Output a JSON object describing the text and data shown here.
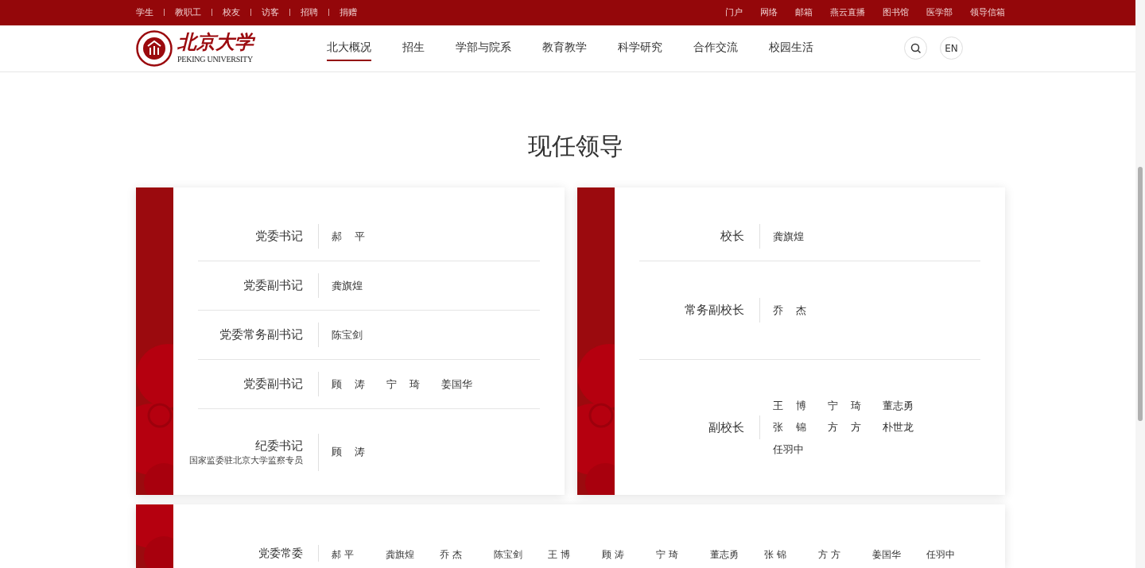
{
  "top_bar": {
    "left_links": [
      "学生",
      "教职工",
      "校友",
      "访客",
      "招聘",
      "捐赠"
    ],
    "right_links": [
      "门户",
      "网络",
      "邮箱",
      "燕云直播",
      "图书馆",
      "医学部",
      "领导信箱"
    ]
  },
  "header": {
    "logo": {
      "chinese": "北京大学",
      "english": "PEKING UNIVERSITY"
    },
    "nav": [
      {
        "label": "北大概况",
        "selected": true
      },
      {
        "label": "招生",
        "selected": false
      },
      {
        "label": "学部与院系",
        "selected": false
      },
      {
        "label": "教育教学",
        "selected": false
      },
      {
        "label": "科学研究",
        "selected": false
      },
      {
        "label": "合作交流",
        "selected": false
      },
      {
        "label": "校园生活",
        "selected": false
      }
    ],
    "language_button": "EN"
  },
  "page_title": "现任领导",
  "cards": [
    {
      "rows": [
        {
          "title": "党委书记",
          "names": [
            "郝 平"
          ]
        },
        {
          "title": "党委副书记",
          "names": [
            "龚旗煌"
          ]
        },
        {
          "title": "党委常务副书记",
          "names": [
            "陈宝剑"
          ]
        },
        {
          "title": "党委副书记",
          "names": [
            "顾 涛",
            "宁 琦",
            "姜国华"
          ]
        },
        {
          "title": "纪委书记",
          "subtitle": "国家监委驻北京大学监察专员",
          "names": [
            "顾 涛"
          ]
        }
      ]
    },
    {
      "rows": [
        {
          "title": "校长",
          "names": [
            "龚旗煌"
          ]
        },
        {
          "title": "常务副校长",
          "names": [
            "乔 杰"
          ]
        },
        {
          "title": "副校长",
          "names": [
            "王 博",
            "宁 琦",
            "董志勇",
            "张 锦",
            "方 方",
            "朴世龙",
            "任羽中"
          ]
        }
      ]
    }
  ],
  "committee": {
    "title": "党委常委",
    "names": [
      "郝 平",
      "龚旗煌",
      "乔 杰",
      "陈宝剑",
      "王 博",
      "顾 涛",
      "宁 琦",
      "董志勇",
      "张 锦",
      "方 方",
      "姜国华",
      "任羽中"
    ]
  }
}
